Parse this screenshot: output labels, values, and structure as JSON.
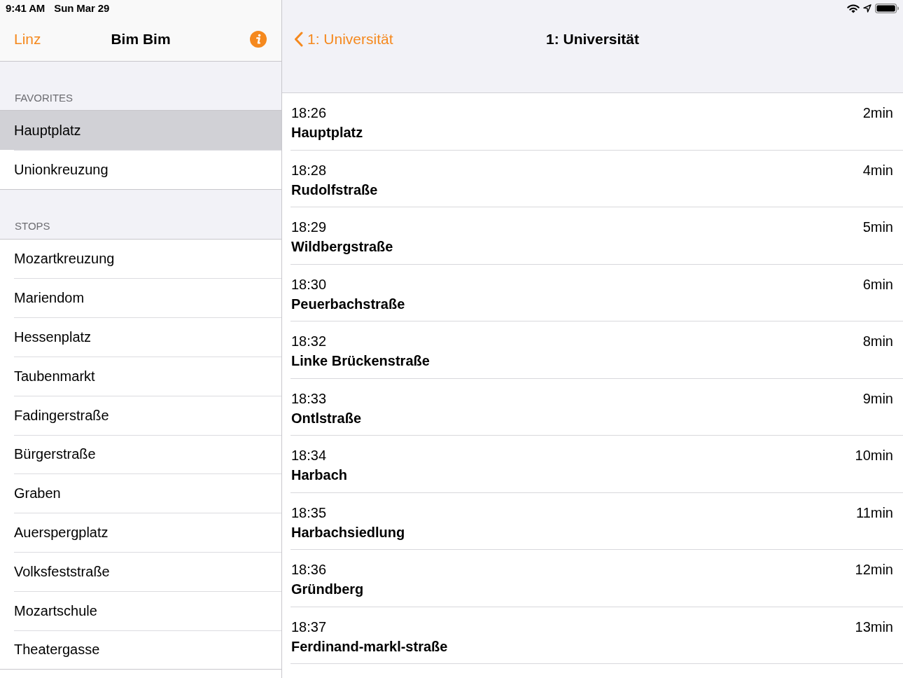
{
  "status_bar": {
    "time": "9:41 AM",
    "date": "Sun Mar 29"
  },
  "sidebar": {
    "back_label": "Linz",
    "title": "Bim Bim",
    "sections": [
      {
        "header": "FAVORITES",
        "items": [
          {
            "label": "Hauptplatz",
            "selected": true
          },
          {
            "label": "Unionkreuzung",
            "selected": false
          }
        ]
      },
      {
        "header": "STOPS",
        "items": [
          {
            "label": "Mozartkreuzung",
            "selected": false
          },
          {
            "label": "Mariendom",
            "selected": false
          },
          {
            "label": "Hessenplatz",
            "selected": false
          },
          {
            "label": "Taubenmarkt",
            "selected": false
          },
          {
            "label": "Fadingerstraße",
            "selected": false
          },
          {
            "label": "Bürgerstraße",
            "selected": false
          },
          {
            "label": "Graben",
            "selected": false
          },
          {
            "label": "Auerspergplatz",
            "selected": false
          },
          {
            "label": "Volksfeststraße",
            "selected": false
          },
          {
            "label": "Mozartschule",
            "selected": false
          },
          {
            "label": "Theatergasse",
            "selected": false
          }
        ]
      }
    ]
  },
  "detail": {
    "back_label": "1: Universität",
    "title": "1: Universität",
    "departures": [
      {
        "time": "18:26",
        "stop": "Hauptplatz",
        "minutes": "2min"
      },
      {
        "time": "18:28",
        "stop": "Rudolfstraße",
        "minutes": "4min"
      },
      {
        "time": "18:29",
        "stop": "Wildbergstraße",
        "minutes": "5min"
      },
      {
        "time": "18:30",
        "stop": "Peuerbachstraße",
        "minutes": "6min"
      },
      {
        "time": "18:32",
        "stop": "Linke Brückenstraße",
        "minutes": "8min"
      },
      {
        "time": "18:33",
        "stop": "Ontlstraße",
        "minutes": "9min"
      },
      {
        "time": "18:34",
        "stop": "Harbach",
        "minutes": "10min"
      },
      {
        "time": "18:35",
        "stop": "Harbachsiedlung",
        "minutes": "11min"
      },
      {
        "time": "18:36",
        "stop": "Gründberg",
        "minutes": "12min"
      },
      {
        "time": "18:37",
        "stop": "Ferdinand-markl-straße",
        "minutes": "13min"
      }
    ]
  }
}
